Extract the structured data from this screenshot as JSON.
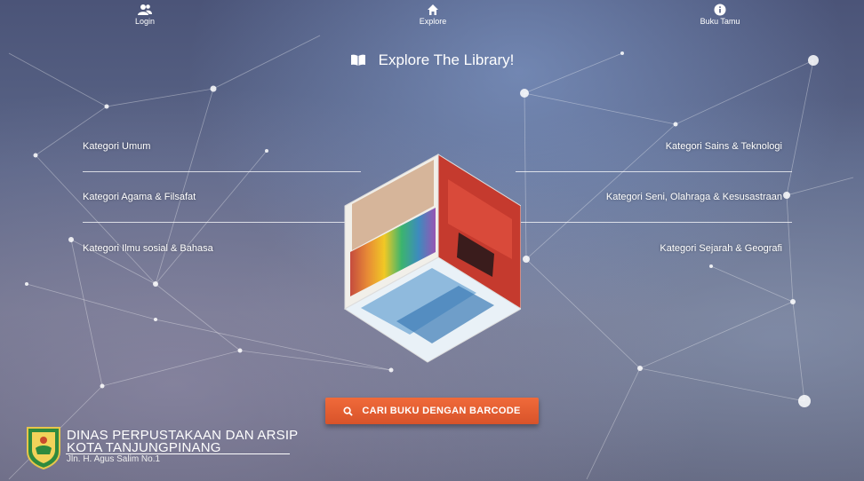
{
  "nav": {
    "login": {
      "label": "Login",
      "icon": "users-icon"
    },
    "explore": {
      "label": "Explore",
      "icon": "home-icon"
    },
    "guestbook": {
      "label": "Buku Tamu",
      "icon": "info-icon"
    }
  },
  "hero": {
    "title": "Explore The Library!",
    "icon": "book-open-icon"
  },
  "categories": {
    "left": [
      "Kategori Umum",
      "Kategori Agama & Filsafat",
      "Kategori Ilmu sosial & Bahasa"
    ],
    "right": [
      "Kategori Sains & Teknologi",
      "Kategori Seni, Olahraga & Kesusastraan",
      "Kategori Sejarah & Geografi"
    ]
  },
  "barcode_button": {
    "label": "CARI BUKU DENGAN BARCODE",
    "icon": "search-icon"
  },
  "footer": {
    "org_line1": "DINAS PERPUSTAKAAN DAN ARSIP",
    "org_line2": "KOTA TANJUNGPINANG",
    "address": "Jln. H. Agus Salim No.1"
  },
  "colors": {
    "accent": "#e8623a",
    "text": "#ffffff"
  }
}
